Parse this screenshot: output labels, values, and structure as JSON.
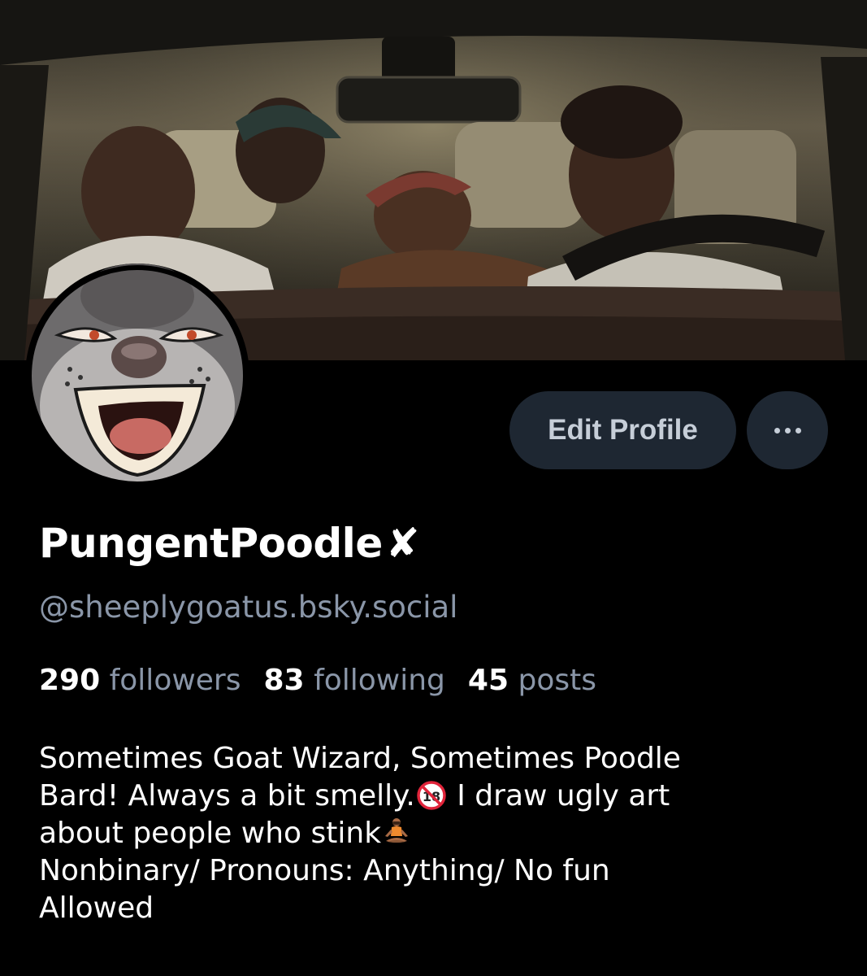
{
  "profile": {
    "display_name": "PungentPoodle",
    "name_badge": "✘",
    "handle": "@sheeplygoatus.bsky.social"
  },
  "actions": {
    "edit_label": "Edit Profile",
    "more_icon": "ellipsis-icon"
  },
  "stats": {
    "followers_count": "290",
    "followers_label": "followers",
    "following_count": "83",
    "following_label": "following",
    "posts_count": "45",
    "posts_label": "posts"
  },
  "bio": {
    "line1": "Sometimes Goat Wizard, Sometimes Poodle",
    "line2_a": "Bard! Always a bit smelly.",
    "line2_emoji": "🔞",
    "line2_b": " I draw ugly art",
    "line3": "about people who stink",
    "line3_emoji": "🧘",
    "line4": "Nonbinary/ Pronouns: Anything/ No fun",
    "line5": "Allowed"
  },
  "colors": {
    "background": "#000000",
    "button_bg": "#1e2732",
    "button_text": "#c6ced8",
    "muted_text": "#8a96a8",
    "primary_text": "#ffffff"
  }
}
